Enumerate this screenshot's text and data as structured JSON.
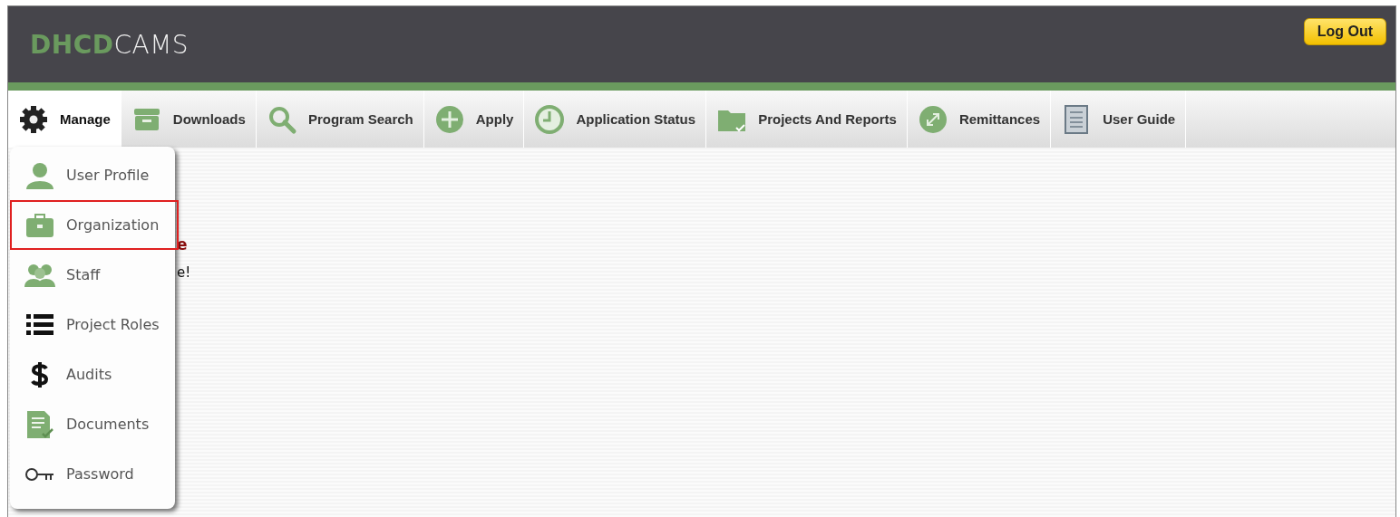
{
  "header": {
    "logo_strong": "DHCD",
    "logo_light": "CAMS",
    "logout": "Log Out"
  },
  "nav": [
    {
      "label": "Manage",
      "selected": true
    },
    {
      "label": "Downloads",
      "selected": false
    },
    {
      "label": "Program Search",
      "selected": false
    },
    {
      "label": "Apply",
      "selected": false
    },
    {
      "label": "Application Status",
      "selected": false
    },
    {
      "label": "Projects And Reports",
      "selected": false
    },
    {
      "label": "Remittances",
      "selected": false
    },
    {
      "label": "User Guide",
      "selected": false
    }
  ],
  "content": [
    {
      "kind": "heading",
      "text": "e"
    },
    {
      "kind": "note",
      "text": "e!"
    }
  ],
  "menu": [
    {
      "label": "User Profile",
      "selected": false
    },
    {
      "label": "Organization",
      "selected": true
    },
    {
      "label": "Staff",
      "selected": false
    },
    {
      "label": "Project Roles",
      "selected": false
    },
    {
      "label": "Audits",
      "selected": false
    },
    {
      "label": "Documents",
      "selected": false
    },
    {
      "label": "Password",
      "selected": false
    }
  ]
}
